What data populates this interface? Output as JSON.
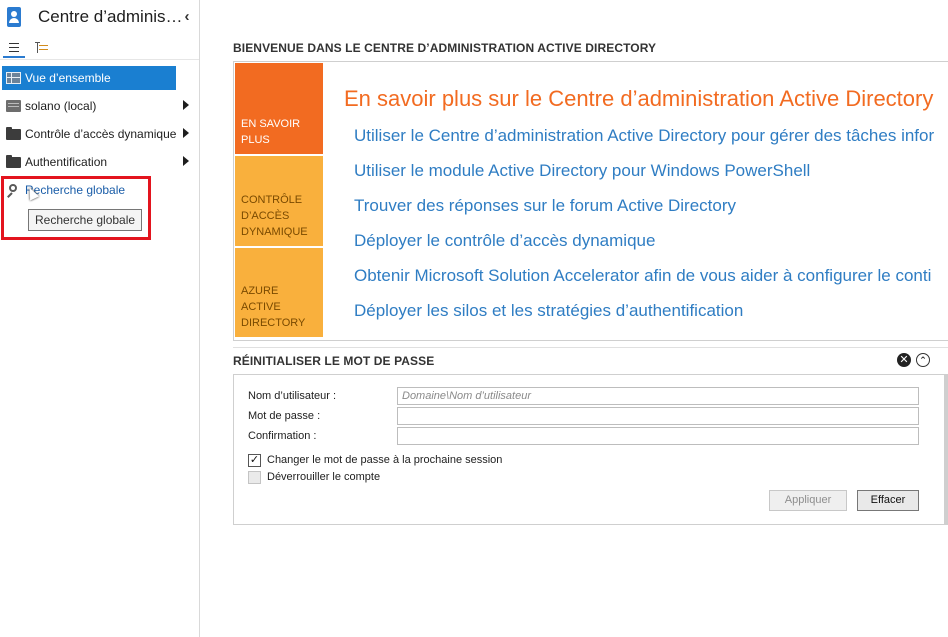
{
  "app": {
    "title": "Centre d’adminis…",
    "collapse_glyph": "‹"
  },
  "icons": {
    "app": "active-directory-user-icon",
    "list_view": "list-view-icon",
    "tree_view": "tree-view-icon",
    "overview": "overview-grid-icon",
    "server": "server-icon",
    "folder": "folder-icon",
    "search": "magnifier-icon"
  },
  "nav": {
    "items": [
      {
        "label": "Vue d’ensemble",
        "selected": true
      },
      {
        "label": "solano (local)",
        "has_children": true
      },
      {
        "label": "Contrôle d’accès dynamique",
        "has_children": true
      },
      {
        "label": "Authentification",
        "has_children": true
      },
      {
        "label": "Recherche globale"
      }
    ],
    "tooltip": "Recherche globale"
  },
  "welcome": {
    "title": "BIENVENUE DANS LE CENTRE D’ADMINISTRATION ACTIVE DIRECTORY",
    "tiles": [
      {
        "label": "EN SAVOIR PLUS",
        "color": "#f26b21"
      },
      {
        "label": "CONTRÔLE D’ACCÈS DYNAMIQUE",
        "color": "#f9b03d"
      },
      {
        "label": "AZURE ACTIVE DIRECTORY",
        "color": "#f9b03d"
      }
    ],
    "heading": "En savoir plus sur le Centre d’administration Active Directory",
    "links": [
      "Utiliser le Centre d’administration Active Directory pour gérer des tâches infor",
      "Utiliser le module Active Directory pour Windows PowerShell",
      "Trouver des réponses sur le forum Active Directory",
      "Déployer le contrôle d’accès dynamique",
      "Obtenir Microsoft Solution Accelerator afin de vous aider à configurer le conti",
      "Déployer les silos et les stratégies d’authentification"
    ]
  },
  "reset_password": {
    "title": "RÉINITIALISER LE MOT DE PASSE",
    "username_label": "Nom d’utilisateur :",
    "username_placeholder": "Domaine\\Nom d’utilisateur",
    "username_value": "",
    "password_label": "Mot de passe :",
    "password_value": "",
    "confirm_label": "Confirmation :",
    "confirm_value": "",
    "change_at_next_logon_label": "Changer le mot de passe à la prochaine session",
    "change_at_next_logon_checked": true,
    "unlock_account_label": "Déverrouiller le compte",
    "unlock_account_checked": false,
    "apply_label": "Appliquer",
    "clear_label": "Effacer",
    "close_glyph": "✕",
    "collapse_glyph": "⌃"
  },
  "colors": {
    "accent": "#1a7fd1",
    "orange": "#f26b21",
    "amber": "#f9b03d",
    "link": "#2f7dc3",
    "highlight": "#e3141e"
  }
}
